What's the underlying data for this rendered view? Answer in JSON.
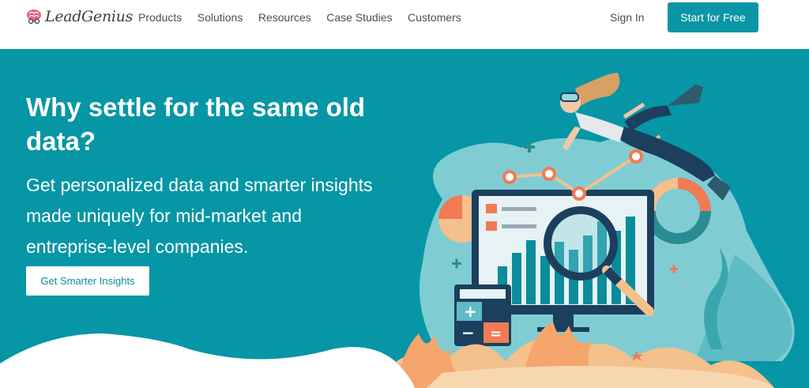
{
  "brand": {
    "name": "LeadGenius"
  },
  "nav": {
    "links": [
      "Products",
      "Solutions",
      "Resources",
      "Case Studies",
      "Customers"
    ],
    "sign_in": "Sign In",
    "cta": "Start for Free"
  },
  "hero": {
    "title": "Why settle for the same old data?",
    "subtitle": "Get personalized data and smarter insights made uniquely for mid-market and entreprise-level companies.",
    "button": "Get Smarter Insights"
  },
  "colors": {
    "accent": "#0a96a5",
    "hero_bg": "#0696a6",
    "coral": "#f07b55",
    "sand": "#f4c08c",
    "navy": "#1c3f5e"
  },
  "icons": [
    "brain-logo-icon",
    "diver-illustration",
    "magnifier-icon",
    "chart-illustration"
  ]
}
